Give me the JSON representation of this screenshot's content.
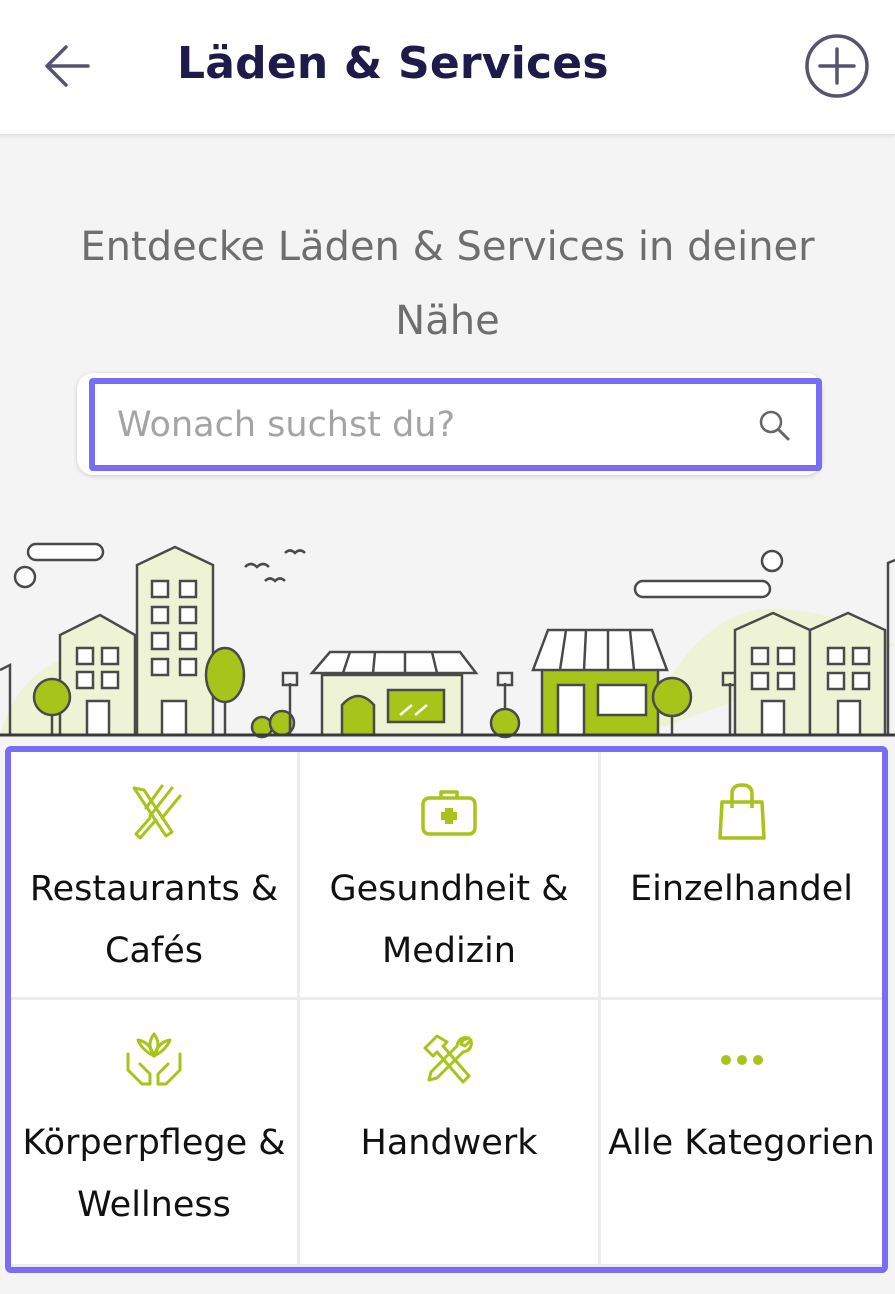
{
  "header": {
    "title": "Läden & Services",
    "back_icon": "arrow-left-icon",
    "add_icon": "plus-circle-icon"
  },
  "main": {
    "tagline": "Entdecke Läden & Services in deiner Nähe",
    "search": {
      "placeholder": "Wonach suchst du?",
      "value": "",
      "icon": "search-icon"
    }
  },
  "categories": [
    {
      "label": "Restaurants & Cafés",
      "icon": "fork-knife-icon"
    },
    {
      "label": "Gesundheit & Medizin",
      "icon": "first-aid-kit-icon"
    },
    {
      "label": "Einzelhandel",
      "icon": "shopping-bag-icon"
    },
    {
      "label": "Körperpflege & Wellness",
      "icon": "lotus-hands-icon"
    },
    {
      "label": "Handwerk",
      "icon": "hammer-wrench-icon"
    },
    {
      "label": "Alle Kategorien",
      "icon": "more-dots-icon"
    }
  ],
  "colors": {
    "brand": "#1e1b4b",
    "accent": "#a6c419",
    "highlight": "#7b6cf6",
    "city_light": "#eef3d6"
  }
}
